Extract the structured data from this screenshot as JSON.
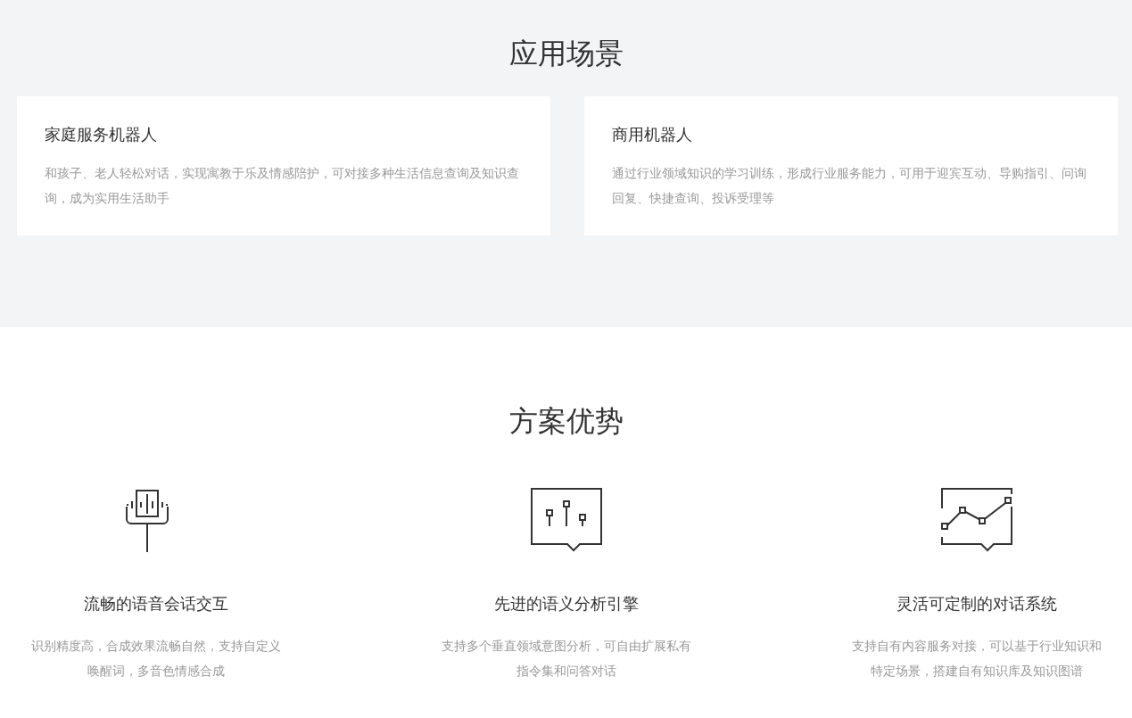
{
  "scenarios": {
    "title": "应用场景",
    "cards": [
      {
        "title": "家庭服务机器人",
        "description": "和孩子、老人轻松对话，实现寓教于乐及情感陪护，可对接多种生活信息查询及知识查询，成为实用生活助手"
      },
      {
        "title": "商用机器人",
        "description": "通过行业领域知识的学习训练，形成行业服务能力，可用于迎宾互动、导购指引、问询回复、快捷查询、投诉受理等"
      }
    ]
  },
  "advantages": {
    "title": "方案优势",
    "items": [
      {
        "kind": "voice",
        "title": "流畅的语音会话交互",
        "description": "识别精度高，合成效果流畅自然，支持自定义唤醒词，多音色情感合成"
      },
      {
        "kind": "semantic",
        "title": "先进的语义分析引擎",
        "description": "支持多个垂直领域意图分析，可自由扩展私有指令集和问答对话"
      },
      {
        "kind": "chart",
        "title": "灵活可定制的对话系统",
        "description": "支持自有内容服务对接，可以基于行业知识和特定场景，搭建自有知识库及知识图谱"
      }
    ]
  }
}
